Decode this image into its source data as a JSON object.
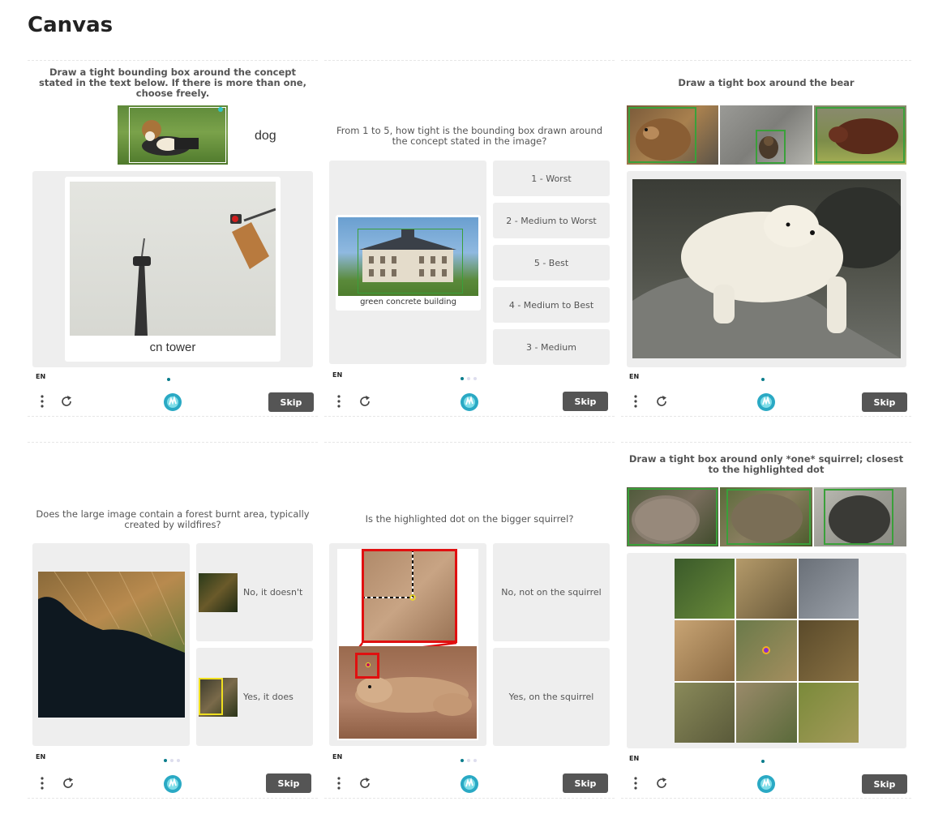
{
  "page": {
    "title": "Canvas"
  },
  "common": {
    "lang": "EN",
    "skip_label": "Skip"
  },
  "cards": [
    {
      "prompt": "Draw a tight bounding box around the concept stated in the text below. If there is more than one, choose freely.",
      "example_label": "dog",
      "caption": "cn tower"
    },
    {
      "prompt": "From 1 to 5, how tight is the bounding box drawn around the concept stated in the image?",
      "caption": "green concrete building",
      "options": [
        "1 - Worst",
        "2 - Medium to Worst",
        "5 - Best",
        "4 - Medium to Best",
        "3 - Medium"
      ]
    },
    {
      "prompt": "Draw a tight box around the bear"
    },
    {
      "prompt": "Does the large image contain a forest burnt area, typically created by wildfires?",
      "options": [
        "No, it doesn't",
        "Yes, it does"
      ]
    },
    {
      "prompt": "Is the highlighted dot on the bigger squirrel?",
      "options": [
        "No, not on the squirrel",
        "Yes, on the squirrel"
      ]
    },
    {
      "prompt": "Draw a tight box around only *one* squirrel; closest to the highlighted dot"
    }
  ],
  "colors": {
    "accent": "#0a7d8c",
    "bbox": "#3aa03a",
    "highlight_red": "#e01010",
    "highlight_yellow": "#f0e020",
    "skip_bg": "#555555"
  },
  "icons": [
    "more-vertical-icon",
    "refresh-icon",
    "hcaptcha-logo-icon"
  ]
}
